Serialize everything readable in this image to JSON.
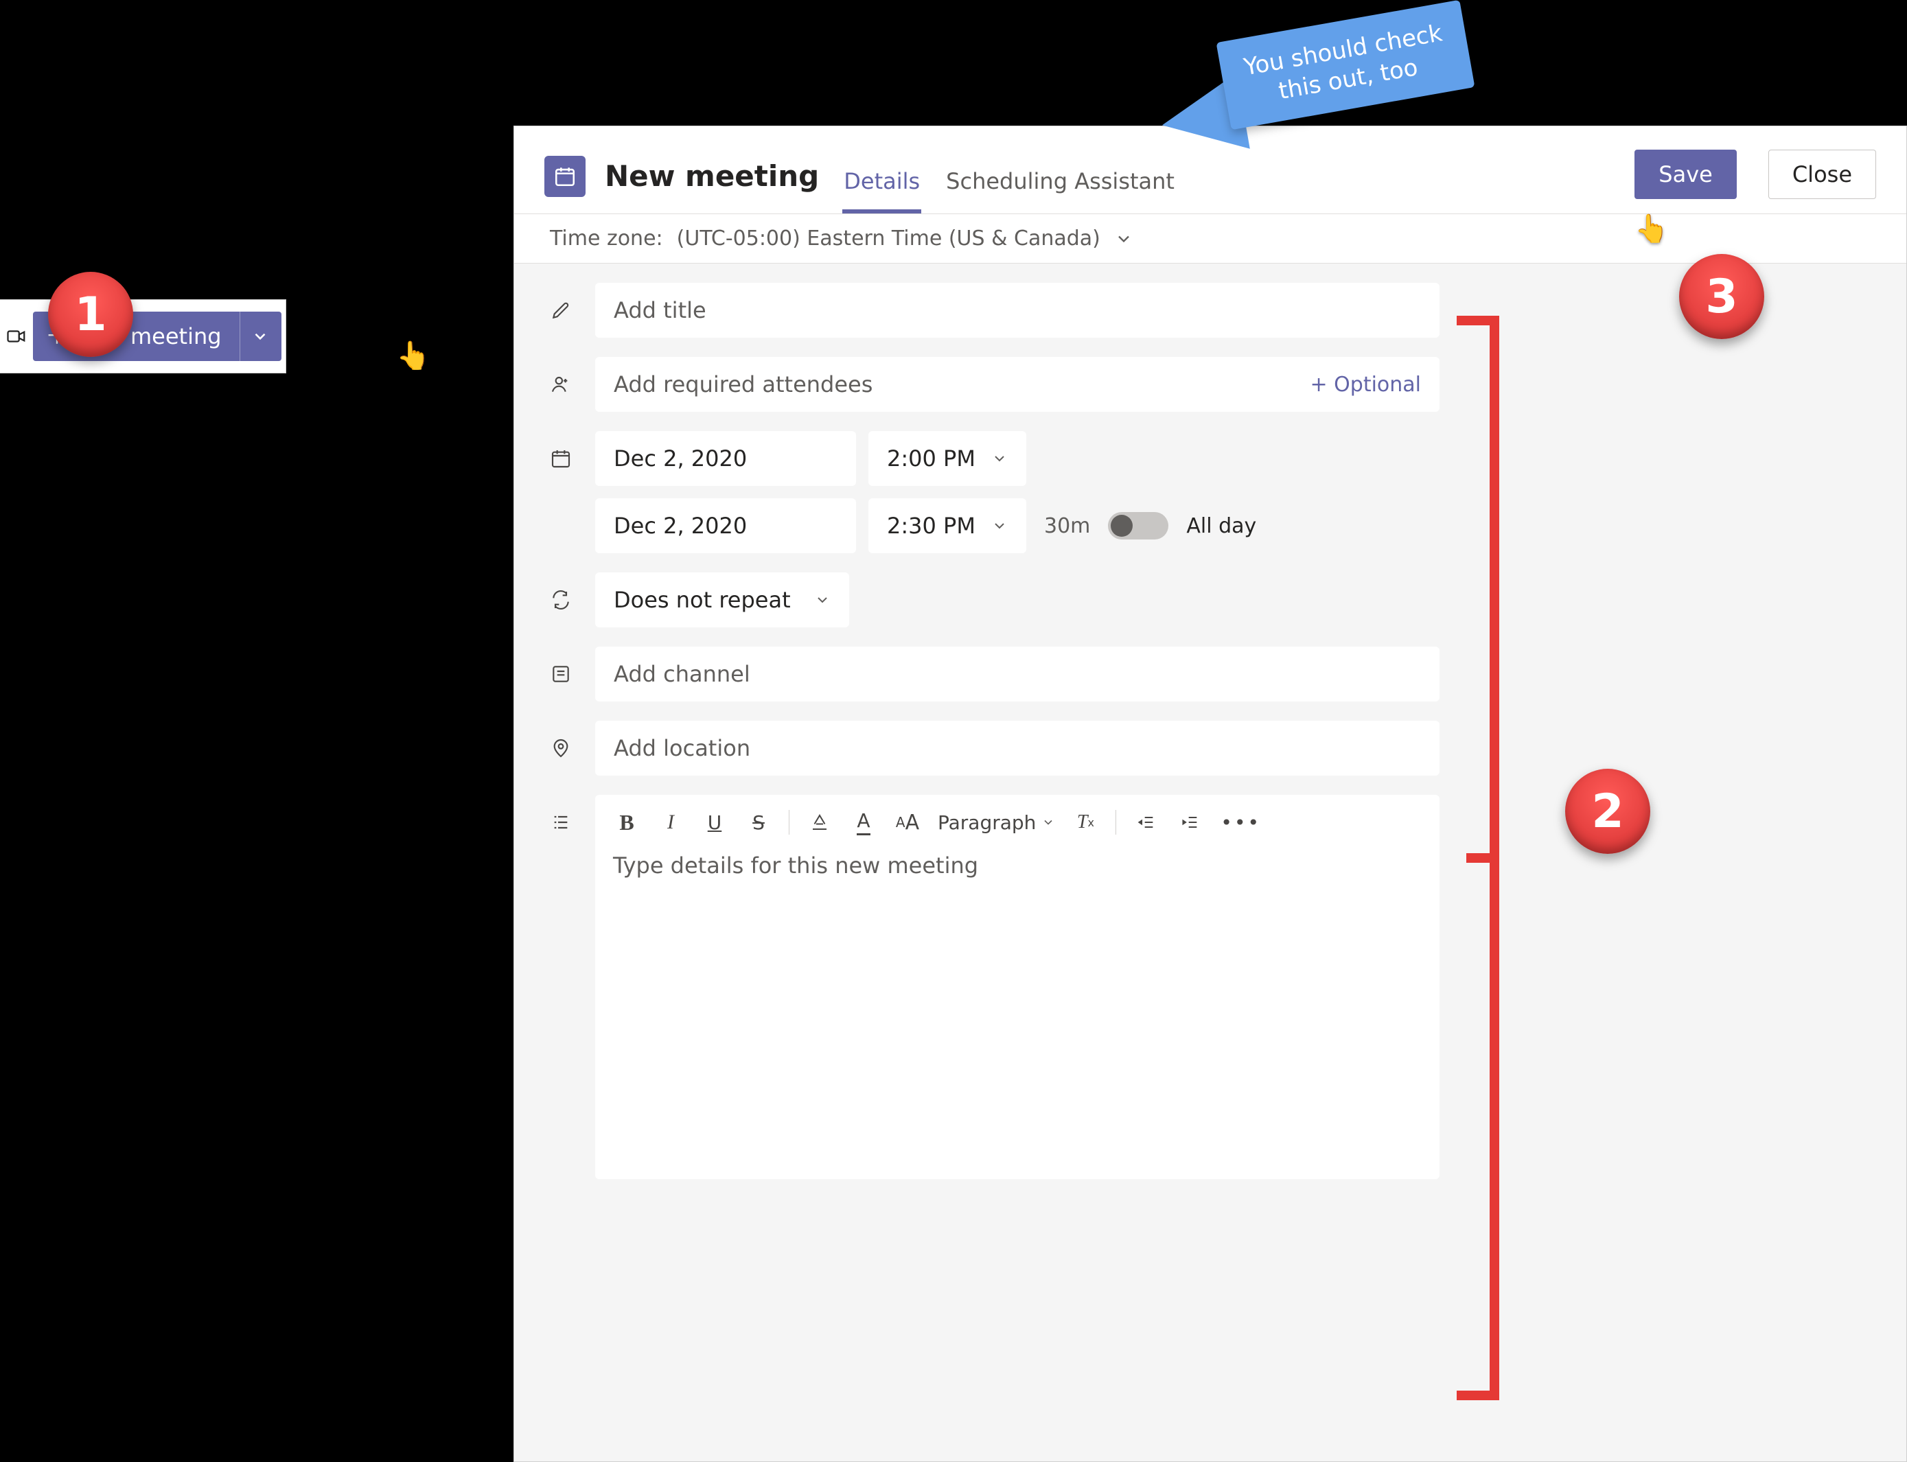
{
  "new_meeting_pill": {
    "label": "New meeting"
  },
  "header": {
    "title": "New meeting",
    "tabs": {
      "details": "Details",
      "scheduling": "Scheduling Assistant"
    },
    "save": "Save",
    "close": "Close"
  },
  "timezone": {
    "label": "Time zone:",
    "value": "(UTC-05:00) Eastern Time (US & Canada)"
  },
  "form": {
    "title_placeholder": "Add title",
    "attendees_placeholder": "Add required attendees",
    "optional_link": "+ Optional",
    "start_date": "Dec 2, 2020",
    "start_time": "2:00 PM",
    "end_date": "Dec 2, 2020",
    "end_time": "2:30 PM",
    "duration": "30m",
    "all_day": "All day",
    "repeat": "Does not repeat",
    "channel_placeholder": "Add channel",
    "location_placeholder": "Add location",
    "editor": {
      "paragraph_label": "Paragraph",
      "body_placeholder": "Type details for this new meeting"
    }
  },
  "annotations": {
    "badge1": "1",
    "badge2": "2",
    "badge3": "3",
    "callout": "You should check\nthis out, too"
  }
}
